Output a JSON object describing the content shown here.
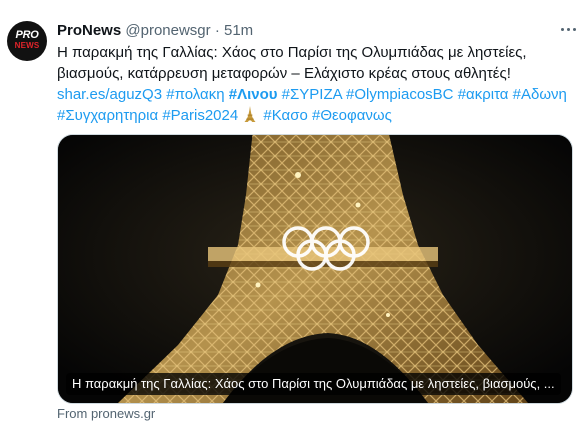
{
  "author": {
    "avatar_text_top": "PRO",
    "avatar_text_bottom": "NEWS",
    "name": "ProNews",
    "handle": "@pronewsgr",
    "separator": "·",
    "time": "51m"
  },
  "tweet": {
    "line1": "Η παρακμή της Γαλλίας: Χάος στο Παρίσι της Ολυμπιάδας με ληστείες,",
    "line2": "βιασμούς, κατάρρευση μεταφορών – Ελάχιστο κρέας στους αθλητές!",
    "link_url": "shar.es/aguzQ3",
    "hashtags_line3": [
      "#πολακη",
      "#Λινου",
      "#ΣΥΡΙΖΑ",
      "#OlympiacosBC",
      "#ακριτα",
      "#Αδωνη"
    ],
    "hashtags_line4": [
      "#Συγχαρητηρια",
      "#Paris2024"
    ],
    "emoji": "eiffel-tower",
    "hashtags_line4b": [
      "#Κασο",
      "#Θεοφανως"
    ]
  },
  "card": {
    "caption": "Η παρακμή της Γαλλίας: Χάος στο Παρίσι της Ολυμπιάδας με ληστείες, βιασμούς, ..."
  },
  "source": "From pronews.gr",
  "colors": {
    "link": "#1d9bf0",
    "text": "#0f1419",
    "muted": "#536471",
    "border": "#cfd9de"
  }
}
